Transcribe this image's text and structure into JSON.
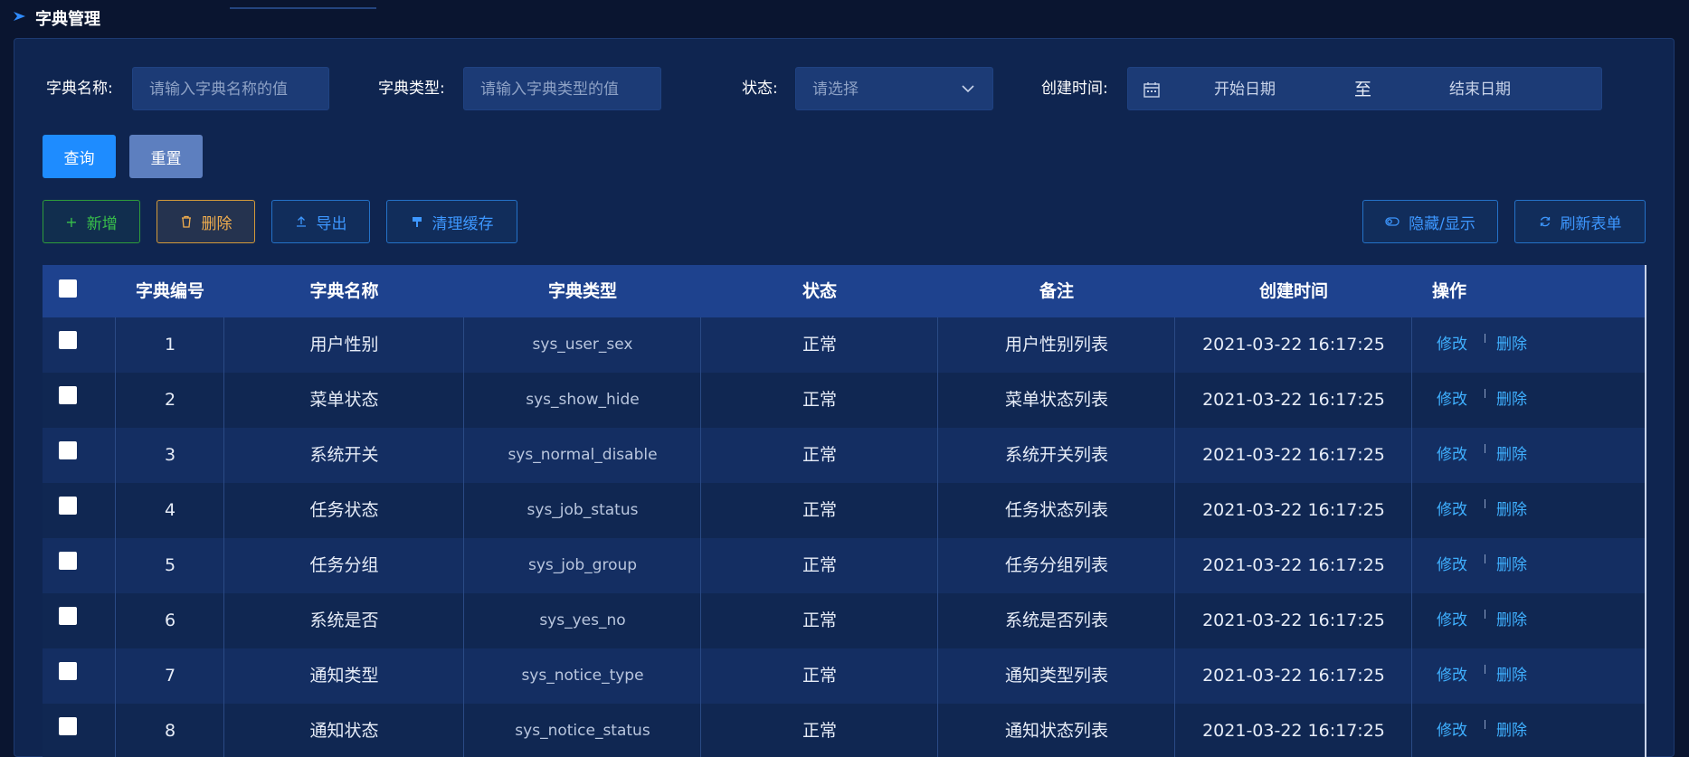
{
  "header": {
    "title": "字典管理"
  },
  "search": {
    "name_label": "字典名称:",
    "name_placeholder": "请输入字典名称的值",
    "type_label": "字典类型:",
    "type_placeholder": "请输入字典类型的值",
    "status_label": "状态:",
    "status_placeholder": "请选择",
    "time_label": "创建时间:",
    "start_date": "开始日期",
    "range_sep": "至",
    "end_date": "结束日期",
    "query_label": "查询",
    "reset_label": "重置"
  },
  "toolbar": {
    "add_label": "新增",
    "delete_label": "删除",
    "export_label": "导出",
    "clear_cache_label": "清理缓存",
    "toggle_label": "隐藏/显示",
    "refresh_label": "刷新表单"
  },
  "table": {
    "columns": [
      "字典编号",
      "字典名称",
      "字典类型",
      "状态",
      "备注",
      "创建时间",
      "操作"
    ],
    "rows": [
      {
        "id": "1",
        "name": "用户性别",
        "type": "sys_user_sex",
        "status": "正常",
        "remark": "用户性别列表",
        "created": "2021-03-22 16:17:25"
      },
      {
        "id": "2",
        "name": "菜单状态",
        "type": "sys_show_hide",
        "status": "正常",
        "remark": "菜单状态列表",
        "created": "2021-03-22 16:17:25"
      },
      {
        "id": "3",
        "name": "系统开关",
        "type": "sys_normal_disable",
        "status": "正常",
        "remark": "系统开关列表",
        "created": "2021-03-22 16:17:25"
      },
      {
        "id": "4",
        "name": "任务状态",
        "type": "sys_job_status",
        "status": "正常",
        "remark": "任务状态列表",
        "created": "2021-03-22 16:17:25"
      },
      {
        "id": "5",
        "name": "任务分组",
        "type": "sys_job_group",
        "status": "正常",
        "remark": "任务分组列表",
        "created": "2021-03-22 16:17:25"
      },
      {
        "id": "6",
        "name": "系统是否",
        "type": "sys_yes_no",
        "status": "正常",
        "remark": "系统是否列表",
        "created": "2021-03-22 16:17:25"
      },
      {
        "id": "7",
        "name": "通知类型",
        "type": "sys_notice_type",
        "status": "正常",
        "remark": "通知类型列表",
        "created": "2021-03-22 16:17:25"
      },
      {
        "id": "8",
        "name": "通知状态",
        "type": "sys_notice_status",
        "status": "正常",
        "remark": "通知状态列表",
        "created": "2021-03-22 16:17:25"
      }
    ],
    "row_actions": {
      "edit": "修改",
      "delete": "删除"
    }
  },
  "colors": {
    "accent": "#1e8cff",
    "link": "#3fb0ff",
    "add_green": "#38c04a",
    "delete_orange": "#f0ad4e"
  }
}
